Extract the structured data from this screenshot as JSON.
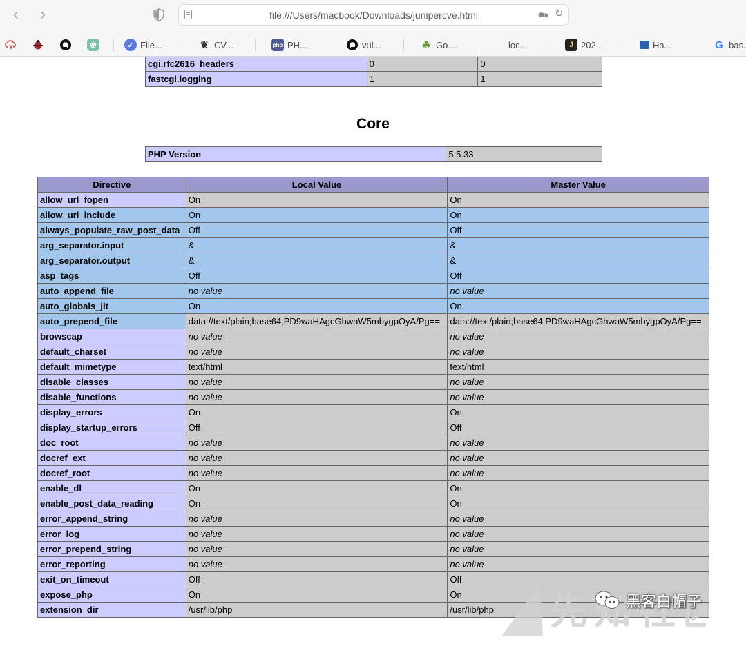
{
  "browser": {
    "url": "file:///Users/macbook/Downloads/junipercve.html",
    "bookmarks": [
      {
        "label": "",
        "icon": "cloud-icon"
      },
      {
        "label": "",
        "icon": "bug-icon"
      },
      {
        "label": "",
        "icon": "github-icon"
      },
      {
        "label": "",
        "icon": "openai-icon"
      },
      {
        "label": "File...",
        "icon": "check-badge-icon"
      },
      {
        "label": "CV...",
        "icon": "cv-icon"
      },
      {
        "label": "PH...",
        "icon": "php-icon"
      },
      {
        "label": "vul...",
        "icon": "github-icon"
      },
      {
        "label": "Go...",
        "icon": "plant-icon"
      },
      {
        "label": "loc...",
        "icon": ""
      },
      {
        "label": "202...",
        "icon": "j-icon"
      },
      {
        "label": "Ha...",
        "icon": "square-icon"
      },
      {
        "label": "bas...",
        "icon": "google-icon"
      }
    ]
  },
  "top_rows": [
    {
      "name": "cgi.rfc2616_headers",
      "local": "0",
      "master": "0"
    },
    {
      "name": "fastcgi.logging",
      "local": "1",
      "master": "1"
    }
  ],
  "section_title": "Core",
  "php_version": {
    "label": "PHP Version",
    "value": "5.5.33"
  },
  "headers": {
    "directive": "Directive",
    "local": "Local Value",
    "master": "Master Value"
  },
  "directives": [
    {
      "name": "allow_url_fopen",
      "local": "On",
      "master": "On",
      "nv": false,
      "hl": false
    },
    {
      "name": "allow_url_include",
      "local": "On",
      "master": "On",
      "nv": false,
      "hl": true
    },
    {
      "name": "always_populate_raw_post_data",
      "local": "Off",
      "master": "Off",
      "nv": false,
      "hl": true
    },
    {
      "name": "arg_separator.input",
      "local": "&",
      "master": "&",
      "nv": false,
      "hl": true
    },
    {
      "name": "arg_separator.output",
      "local": "&",
      "master": "&",
      "nv": false,
      "hl": true
    },
    {
      "name": "asp_tags",
      "local": "Off",
      "master": "Off",
      "nv": false,
      "hl": true
    },
    {
      "name": "auto_append_file",
      "local": "no value",
      "master": "no value",
      "nv": true,
      "hl": true
    },
    {
      "name": "auto_globals_jit",
      "local": "On",
      "master": "On",
      "nv": false,
      "hl": true
    },
    {
      "name": "auto_prepend_file",
      "local": "data://text/plain;base64,PD9waHAgcGhwaW5mbygpOyA/Pg==",
      "master": "data://text/plain;base64,PD9waHAgcGhwaW5mbygpOyA/Pg==",
      "nv": false,
      "hl": "name"
    },
    {
      "name": "browscap",
      "local": "no value",
      "master": "no value",
      "nv": true,
      "hl": false
    },
    {
      "name": "default_charset",
      "local": "no value",
      "master": "no value",
      "nv": true,
      "hl": false
    },
    {
      "name": "default_mimetype",
      "local": "text/html",
      "master": "text/html",
      "nv": false,
      "hl": false
    },
    {
      "name": "disable_classes",
      "local": "no value",
      "master": "no value",
      "nv": true,
      "hl": false
    },
    {
      "name": "disable_functions",
      "local": "no value",
      "master": "no value",
      "nv": true,
      "hl": false
    },
    {
      "name": "display_errors",
      "local": "On",
      "master": "On",
      "nv": false,
      "hl": false
    },
    {
      "name": "display_startup_errors",
      "local": "Off",
      "master": "Off",
      "nv": false,
      "hl": false
    },
    {
      "name": "doc_root",
      "local": "no value",
      "master": "no value",
      "nv": true,
      "hl": false
    },
    {
      "name": "docref_ext",
      "local": "no value",
      "master": "no value",
      "nv": true,
      "hl": false
    },
    {
      "name": "docref_root",
      "local": "no value",
      "master": "no value",
      "nv": true,
      "hl": false
    },
    {
      "name": "enable_dl",
      "local": "On",
      "master": "On",
      "nv": false,
      "hl": false
    },
    {
      "name": "enable_post_data_reading",
      "local": "On",
      "master": "On",
      "nv": false,
      "hl": false
    },
    {
      "name": "error_append_string",
      "local": "no value",
      "master": "no value",
      "nv": true,
      "hl": false
    },
    {
      "name": "error_log",
      "local": "no value",
      "master": "no value",
      "nv": true,
      "hl": false
    },
    {
      "name": "error_prepend_string",
      "local": "no value",
      "master": "no value",
      "nv": true,
      "hl": false
    },
    {
      "name": "error_reporting",
      "local": "no value",
      "master": "no value",
      "nv": true,
      "hl": false
    },
    {
      "name": "exit_on_timeout",
      "local": "Off",
      "master": "Off",
      "nv": false,
      "hl": false
    },
    {
      "name": "expose_php",
      "local": "On",
      "master": "On",
      "nv": false,
      "hl": false
    },
    {
      "name": "extension_dir",
      "local": "/usr/lib/php",
      "master": "/usr/lib/php",
      "nv": false,
      "hl": false
    }
  ],
  "watermark": {
    "text": "黑客白帽子",
    "logo": "先知社区"
  },
  "colors": {
    "header": "#9999cc",
    "directive": "#ccccff",
    "value": "#cccccc",
    "selection": "#a3c7ec"
  }
}
